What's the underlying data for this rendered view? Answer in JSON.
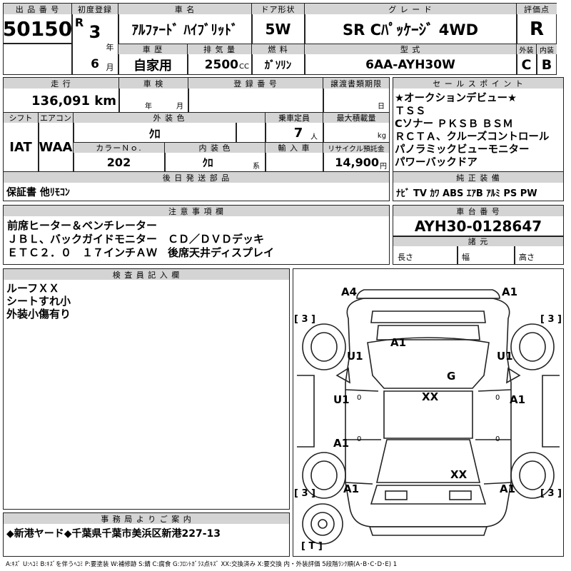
{
  "header": {
    "lot_no_label": "出 品 番 号",
    "lot_no": "50150",
    "first_reg_label": "初度登録",
    "era_mark": "R",
    "reg_year": "3",
    "year_suffix": "年",
    "reg_month": "6",
    "month_suffix": "月",
    "car_name_label": "車 名",
    "car_name": "ｱﾙﾌｧｰﾄﾞ ﾊｲﾌﾞﾘｯﾄﾞ",
    "door_label": "ドア形状",
    "door": "5W",
    "grade_label": "グ レ ー ド",
    "grade": "SR Cﾊﾟｯｹｰｼﾞ 4WD",
    "score_label": "評価点",
    "score": "R",
    "history_label": "車 歴",
    "history": "自家用",
    "displacement_label": "排 気 量",
    "displacement": "2500",
    "displacement_unit": "CC",
    "fuel_label": "燃 料",
    "fuel": "ｶﾞｿﾘﾝ",
    "model_label": "型 式",
    "model": "6AA-AYH30W",
    "ext_label": "外装",
    "int_label": "内装",
    "ext_grade": "C",
    "int_grade": "B"
  },
  "row2": {
    "mileage_label": "走 行",
    "mileage": "136,091 km",
    "inspection_label": "車 検",
    "inspection_year": "年",
    "inspection_month": "月",
    "plate_label": "登 録 番 号",
    "transfer_label": "譲渡書類期限",
    "transfer_day": "日",
    "shift_label": "シフト",
    "shift": "IAT",
    "ac_label": "エアコン",
    "ac": "WAA",
    "color_label": "外 装 色",
    "color": "ｸﾛ",
    "color_no_label": "カラーＮｏ.",
    "color_no": "202",
    "int_color_label": "内 装 色",
    "int_color": "ｸﾛ",
    "int_color_suffix": "系",
    "capacity_label": "乗車定員",
    "capacity": "7",
    "capacity_unit": "人",
    "load_label": "最大積載量",
    "load_unit": "kg",
    "import_label": "輸 入 車",
    "recycle_label": "リサイクル預託金",
    "recycle": "14,900",
    "recycle_unit": "円",
    "later_label": "後 日 発 送 部 品",
    "later": "保証書  他ﾘﾓｺﾝ"
  },
  "sales": {
    "label": "セ ー ル ス ポ イ ン ト",
    "lines": [
      "★オークションデビュー★",
      "ＴＳＳ",
      "Cソナー ＰＫＳＢ ＢＳＭ",
      "ＲＣＴＡ、クルーズコントロール",
      "パノラミックビューモニター",
      "パワーバックドア"
    ],
    "equip_label": "純 正 装 備",
    "equip": "ﾅﾋﾞ  TV  ｶﾜ  ABS  ｴｱB  ｱﾙﾐ  PS  PW"
  },
  "notes": {
    "label": "注 意 事 項 欄",
    "lines": [
      "前席ヒーター＆ベンチレーター",
      "ＪＢＬ、バックガイドモニター　ＣＤ／ＤＶＤデッキ",
      "ＥＴＣ２．０　１７インチＡＷ　後席天井ディスプレイ"
    ]
  },
  "chassis": {
    "label": "車 台 番 号",
    "value": "AYH30-0128647",
    "dims_label": "諸 元",
    "length": "長さ",
    "width": "幅",
    "height": "高さ"
  },
  "inspector": {
    "label": "検 査 員 記 入 欄",
    "lines": [
      "ルーフＸＸ",
      "シートすれ小",
      "外装小傷有り"
    ]
  },
  "office": {
    "label": "事 務 局 よ り ご 案 内",
    "text": "◆新港ヤード◆千葉県千葉市美浜区新港227-13"
  },
  "diagram": {
    "marks": {
      "a4": "A4",
      "a1_tr": "A1",
      "a1_top": "A1",
      "u1_l": "U1",
      "u1_r": "U1",
      "g": "G",
      "xx_c": "XX",
      "u1_ml": "U1",
      "a1_mr": "A1",
      "a1_ml": "A1",
      "a1_bl": "A1",
      "xx_b": "XX",
      "a1_br": "A1",
      "t3_tl": "[ 3 ]",
      "t3_tr": "[ 3 ]",
      "t3_bl": "[ 3 ]",
      "t3_br": "[ 3 ]",
      "t_spare": "[ T ]",
      "zero_l1": "0",
      "zero_r1": "0",
      "zero_l2": "0",
      "zero_r2": "0"
    }
  },
  "legend": "A:ｷｽﾞ U:ﾍｺﾐ B:ｷｽﾞを伴うﾍｺﾐ P:要塗装 W:補修跡 S:錆 C:腐食 G:ﾌﾛﾝﾄｶﾞﾗｽ点ｷｽﾞ XX:交換済み X:要交換  内・外装評価 5段階ﾗﾝｸ順(A･B･C･D･E) 1"
}
